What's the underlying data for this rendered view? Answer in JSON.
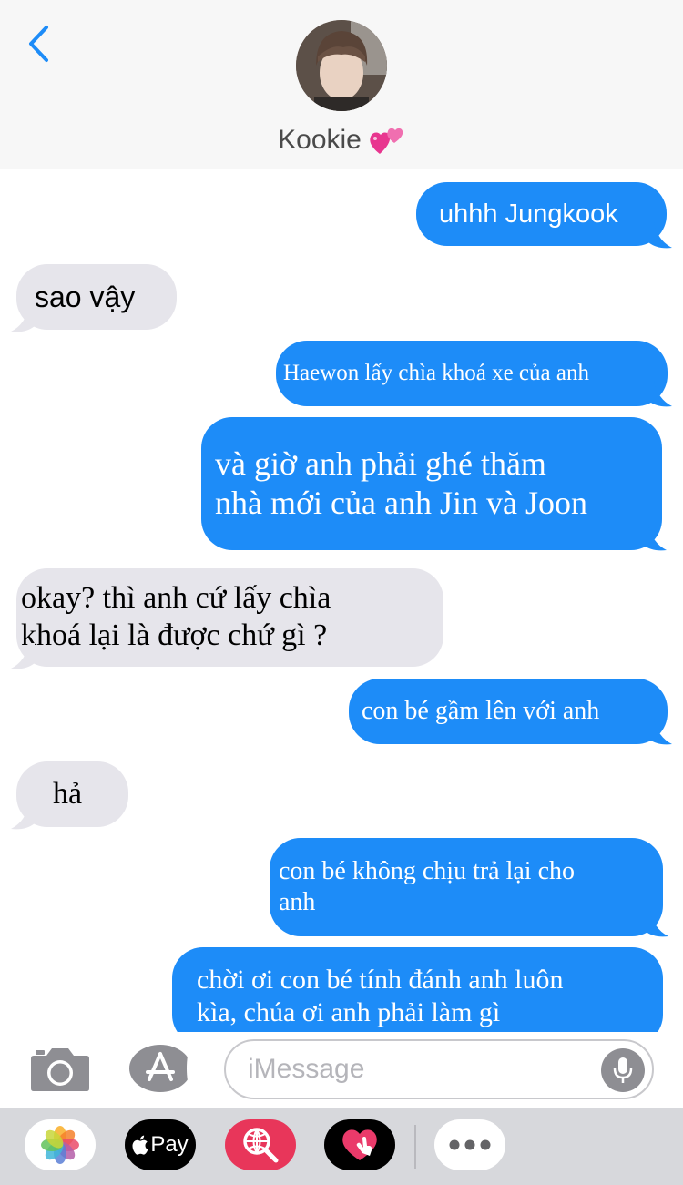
{
  "header": {
    "contact_name": "Kookie",
    "contact_emoji": "💕",
    "back_icon": "chevron-left-icon"
  },
  "messages": [
    {
      "direction": "outgoing",
      "text": "uhhh Jungkook"
    },
    {
      "direction": "incoming",
      "text": "sao vậy"
    },
    {
      "direction": "outgoing",
      "text": "Haewon lấy chìa khoá xe của anh"
    },
    {
      "direction": "outgoing",
      "lines": [
        "và giờ anh phải ghé thăm",
        "nhà mới của anh Jin và Joon"
      ]
    },
    {
      "direction": "incoming",
      "lines": [
        "okay? thì anh cứ lấy chìa",
        "khoá lại là được chứ gì ?"
      ]
    },
    {
      "direction": "outgoing",
      "text": "con bé gầm lên với anh"
    },
    {
      "direction": "incoming",
      "text": "hả"
    },
    {
      "direction": "outgoing",
      "lines": [
        "con bé không chịu trả lại cho",
        "anh"
      ]
    },
    {
      "direction": "outgoing",
      "lines": [
        "chời ơi con bé tính đánh anh luôn",
        "kìa, chúa ơi anh phải làm gì"
      ]
    }
  ],
  "input": {
    "placeholder": "iMessage",
    "value": ""
  },
  "app_drawer": {
    "apple_pay_label": "Pay",
    "apps": [
      "photos-icon",
      "apple-pay-icon",
      "web-search-icon",
      "digital-touch-icon",
      "more-icon"
    ]
  },
  "colors": {
    "outgoing_bubble": "#1d8cf8",
    "incoming_bubble": "#e6e5eb",
    "accent": "#1d8cf8",
    "header_bg": "#f7f7f7",
    "drawer_bg": "#d7d8dc"
  }
}
